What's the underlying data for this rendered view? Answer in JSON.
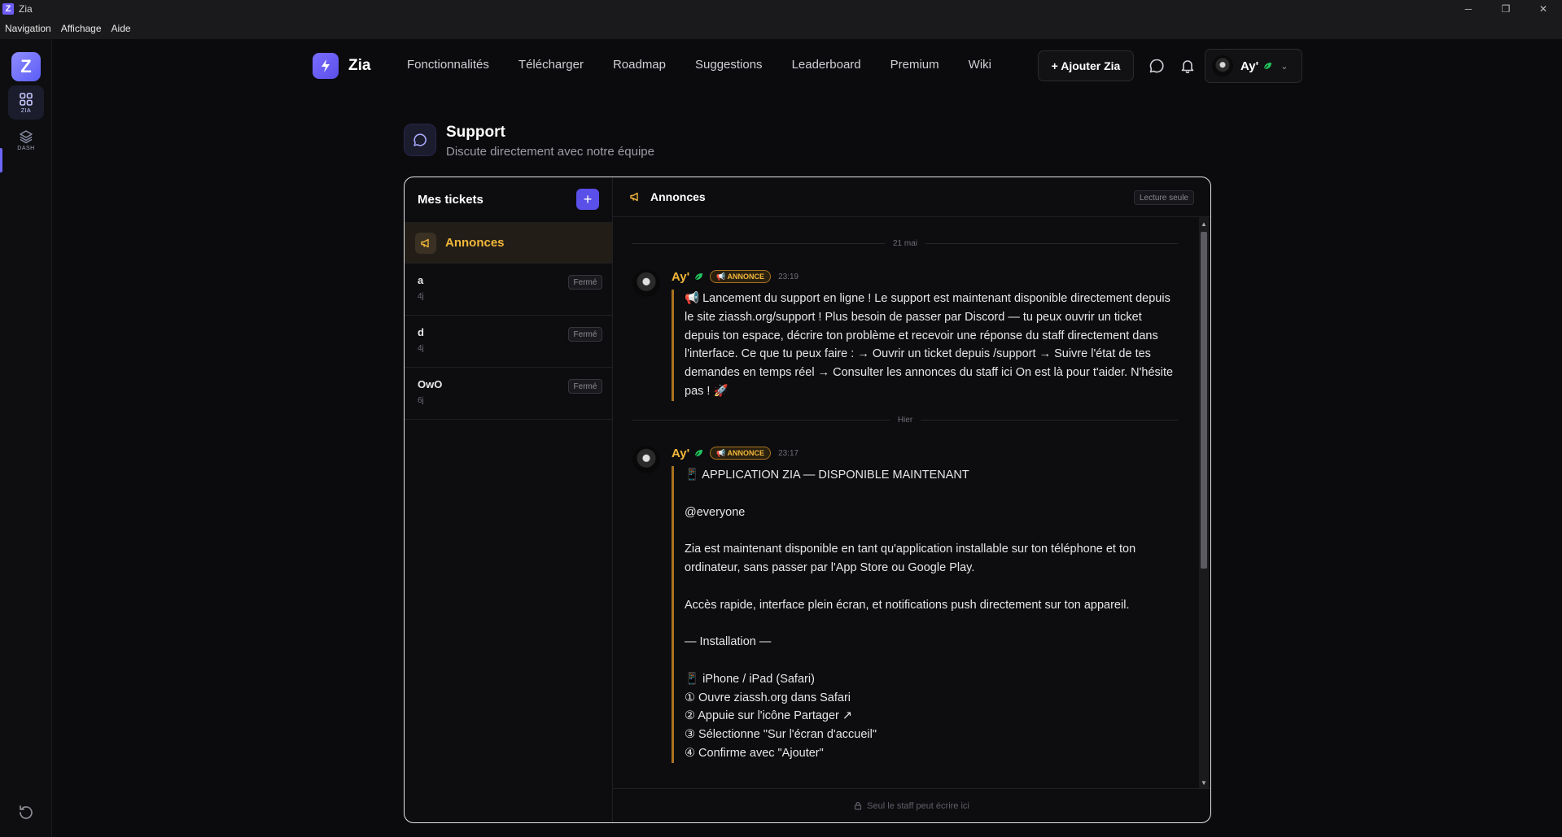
{
  "window": {
    "title": "Zia",
    "menu": [
      "Navigation",
      "Affichage",
      "Aide"
    ]
  },
  "sidebar": {
    "items": [
      {
        "label": "ZIA",
        "icon": "grid-icon"
      },
      {
        "label": "DASH",
        "icon": "layers-icon"
      }
    ],
    "logo": "Z"
  },
  "nav": {
    "brand": "Zia",
    "links": [
      "Fonctionnalités",
      "Télécharger",
      "Roadmap",
      "Suggestions",
      "Leaderboard",
      "Premium",
      "Wiki"
    ],
    "add_button": "+ Ajouter Zia",
    "user": "Ay'"
  },
  "page": {
    "title": "Support",
    "subtitle": "Discute directement avec notre équipe"
  },
  "tickets": {
    "header": "Mes tickets",
    "add": "+",
    "announcements": "Annonces",
    "items": [
      {
        "name": "a",
        "ago": "4j",
        "status": "Fermé"
      },
      {
        "name": "d",
        "ago": "4j",
        "status": "Fermé"
      },
      {
        "name": "OwO",
        "ago": "6j",
        "status": "Fermé"
      }
    ]
  },
  "chat": {
    "title": "Annonces",
    "readonly": "Lecture seule",
    "days": [
      "21 mai",
      "Hier"
    ],
    "messages": [
      {
        "author": "Ay'",
        "tag": "📢 ANNONCE",
        "time": "23:19",
        "body": "📢 Lancement du support en ligne ! Le support est maintenant disponible directement depuis le site ziassh.org/support ! Plus besoin de passer par Discord — tu peux ouvrir un ticket depuis ton espace, décrire ton problème et recevoir une réponse du staff directement dans l'interface. Ce que tu peux faire : → Ouvrir un ticket depuis /support → Suivre l'état de tes demandes en temps réel → Consulter les annonces du staff ici On est là pour t'aider. N'hésite pas ! 🚀"
      },
      {
        "author": "Ay'",
        "tag": "📢 ANNONCE",
        "time": "23:17",
        "body": "📱 APPLICATION ZIA — DISPONIBLE MAINTENANT\n\n@everyone\n\nZia est maintenant disponible en tant qu'application installable sur ton téléphone et ton ordinateur, sans passer par l'App Store ou Google Play.\n\nAccès rapide, interface plein écran, et notifications push directement sur ton appareil.\n\n— Installation —\n\n📱 iPhone / iPad (Safari)\n① Ouvre ziassh.org dans Safari\n② Appuie sur l'icône Partager ↗\n③ Sélectionne \"Sur l'écran d'accueil\"\n④ Confirme avec \"Ajouter\""
      }
    ],
    "composer": "Seul le staff peut écrire ici"
  },
  "colors": {
    "accent": "#5a4fe8",
    "announce": "#f2b73a",
    "border": "#e5e5e5"
  }
}
